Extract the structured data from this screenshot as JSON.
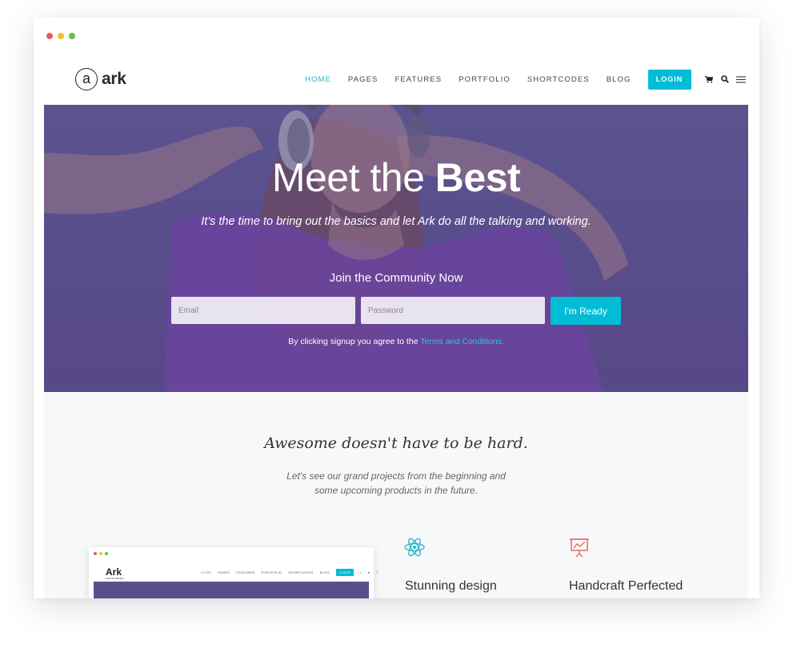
{
  "window": {
    "dot_colors": [
      "#ec5b53",
      "#f2bf2f",
      "#5fc04a"
    ]
  },
  "header": {
    "logo_mark": "a",
    "logo_text": "ark",
    "nav": [
      {
        "label": "HOME",
        "active": true
      },
      {
        "label": "PAGES",
        "active": false
      },
      {
        "label": "FEATURES",
        "active": false
      },
      {
        "label": "PORTFOLIO",
        "active": false
      },
      {
        "label": "SHORTCODES",
        "active": false
      },
      {
        "label": "BLOG",
        "active": false
      }
    ],
    "login_label": "LOGIN",
    "icons": [
      "cart-icon",
      "search-icon",
      "menu-icon"
    ]
  },
  "hero": {
    "title_light": "Meet the ",
    "title_bold": "Best",
    "subtitle": "It's the time to bring out the basics and let Ark do all the talking and working.",
    "community": "Join the Community Now",
    "email_placeholder": "Email",
    "password_placeholder": "Password",
    "button_label": "I'm Ready",
    "terms_prefix": "By clicking signup you agree to the ",
    "terms_link": "Terms and Conditions."
  },
  "section": {
    "title": "Awesome doesn't have to be hard.",
    "subtitle_line1": "Let's see our grand projects from the beginning and",
    "subtitle_line2": "some upcoming products in the future."
  },
  "preview": {
    "logo": "Ark",
    "logo_sub": "FRONTENDS",
    "nav": [
      "HOME",
      "PAGES",
      "FEATURES",
      "PORTFOLIO",
      "SHORTCODES",
      "BLOG"
    ],
    "login": "LOGIN"
  },
  "features": [
    {
      "icon": "atom-icon",
      "title": "Stunning design",
      "color": "#1eb4cc"
    },
    {
      "icon": "presentation-icon",
      "title": "Handcraft Perfected",
      "color": "#e2584c"
    }
  ],
  "colors": {
    "accent": "#00bcd4",
    "hero_overlay": "#5a508d"
  }
}
